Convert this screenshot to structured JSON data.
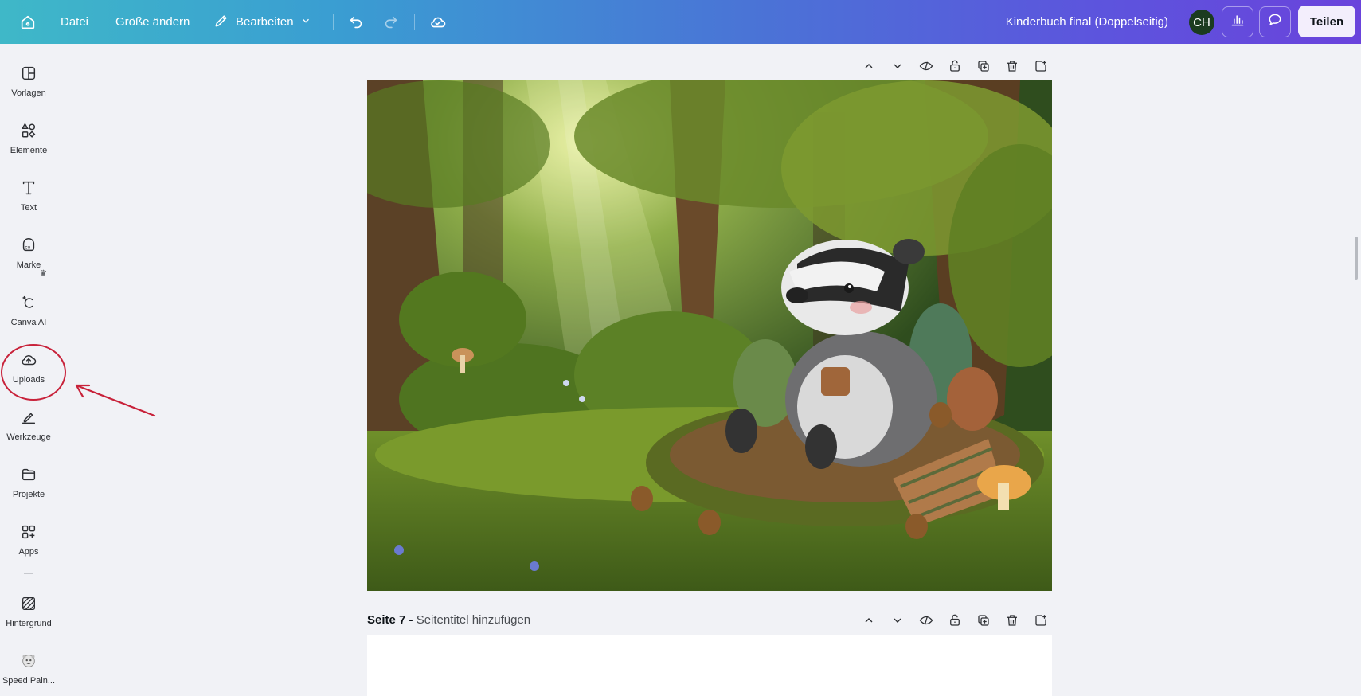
{
  "topbar": {
    "home_icon": "home-icon",
    "file_label": "Datei",
    "resize_label": "Größe ändern",
    "edit_label": "Bearbeiten",
    "undo_icon": "undo-icon",
    "redo_icon": "redo-icon",
    "cloud_icon": "cloud-check-icon",
    "document_title": "Kinderbuch final (Doppelseitig)",
    "avatar_initials": "CH",
    "share_label": "Teilen"
  },
  "sidebar": {
    "items": [
      {
        "label": "Vorlagen",
        "icon": "templates-icon"
      },
      {
        "label": "Elemente",
        "icon": "elements-icon"
      },
      {
        "label": "Text",
        "icon": "text-icon"
      },
      {
        "label": "Marke",
        "icon": "brand-icon"
      },
      {
        "label": "Canva AI",
        "icon": "canva-ai-icon"
      },
      {
        "label": "Uploads",
        "icon": "upload-cloud-icon"
      },
      {
        "label": "Werkzeuge",
        "icon": "tools-icon"
      },
      {
        "label": "Projekte",
        "icon": "folder-icon"
      },
      {
        "label": "Apps",
        "icon": "apps-icon"
      },
      {
        "label": "Hintergrund",
        "icon": "background-icon"
      },
      {
        "label": "Speed Pain...",
        "icon": "speed-painting-app-icon"
      }
    ]
  },
  "page_toolbar_icons": [
    "chevron-up-icon",
    "chevron-down-icon",
    "hide-icon",
    "lock-icon",
    "duplicate-icon",
    "trash-icon",
    "add-page-icon"
  ],
  "page7": {
    "number_label": "Seite 7 -",
    "title_placeholder": "Seitentitel hinzufügen"
  },
  "colors": {
    "annotation": "#c8223a",
    "avatar_bg": "#1b3b1f"
  }
}
